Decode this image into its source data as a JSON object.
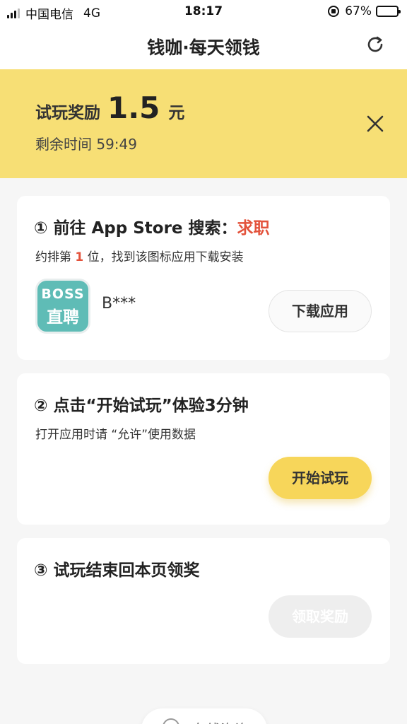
{
  "status_bar": {
    "carrier": "中国电信",
    "network": "4G",
    "time": "18:17",
    "battery_text": "67%",
    "battery_level": 0.67
  },
  "nav": {
    "title": "钱咖·每天领钱",
    "refresh_icon": "refresh-icon"
  },
  "banner": {
    "reward_label": "试玩奖励",
    "reward_amount": "1.5",
    "reward_unit": "元",
    "countdown_label": "剩余时间",
    "countdown_value": "59:49",
    "close_icon": "close-icon"
  },
  "step1": {
    "title_prefix": "① 前往 App Store 搜索：",
    "keyword": "求职",
    "sub_prefix": "约排第",
    "rank": "1",
    "sub_suffix": "位，找到该图标应用下载安装",
    "app_icon_line1": "BOSS",
    "app_icon_line2": "直聘",
    "app_name": "B***",
    "button_label": "下载应用"
  },
  "step2": {
    "title": "② 点击“开始试玩”体验3分钟",
    "sub": "打开应用时请 “允许”使用数据",
    "button_label": "开始试玩"
  },
  "step3": {
    "title": "③ 试玩结束回本页领奖",
    "button_label": "领取奖励"
  },
  "footer": {
    "online_label": "在线咨询"
  },
  "colors": {
    "banner_bg": "#f7df75",
    "accent_red": "#e3523b",
    "primary_button": "#f7d65a",
    "app_icon_bg": "#5fbcb6"
  }
}
